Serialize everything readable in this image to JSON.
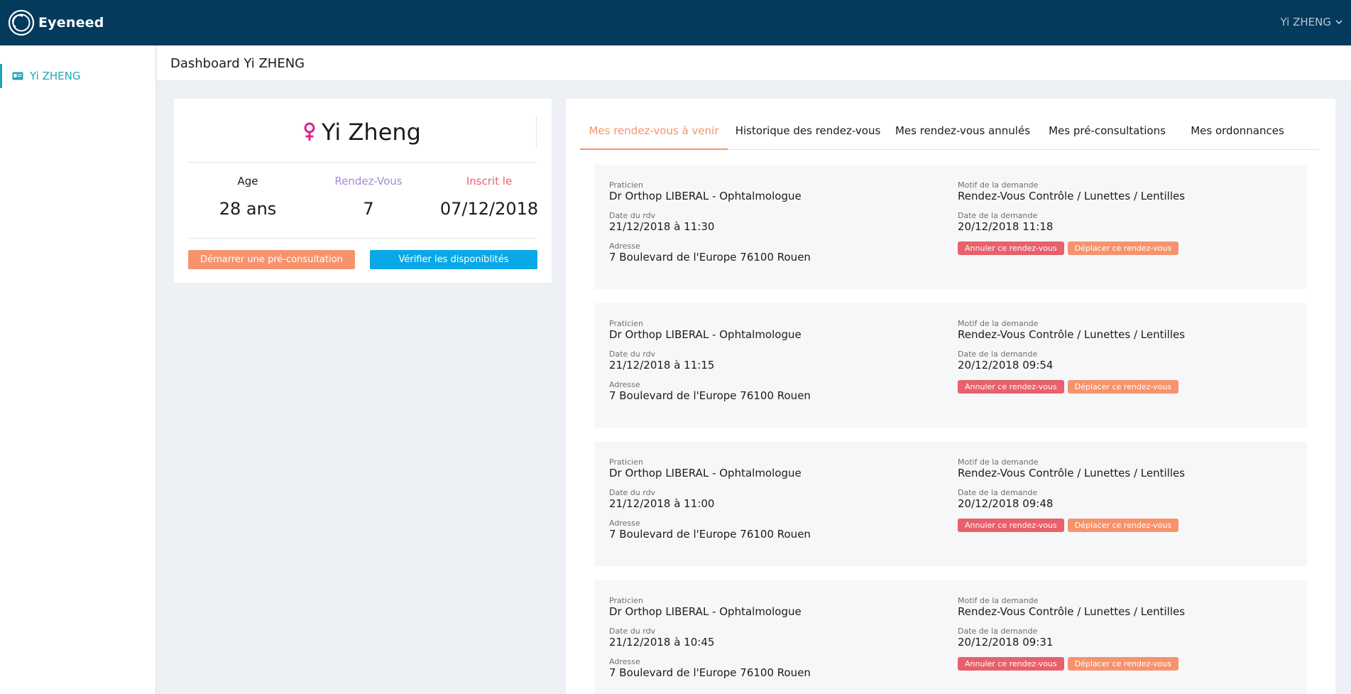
{
  "app": {
    "name": "Eyeneed",
    "user_menu": "Yi ZHENG"
  },
  "sidebar": {
    "items": [
      {
        "label": "Yi ZHENG",
        "icon": "id-card-icon"
      }
    ]
  },
  "page": {
    "title": "Dashboard Yi ZHENG"
  },
  "profile": {
    "gender_icon": "female-icon",
    "name": "Yi Zheng",
    "stats": [
      {
        "label": "Age",
        "value": "28 ans",
        "color": "#1b1b1b"
      },
      {
        "label": "Rendez-Vous",
        "value": "7",
        "color": "#a58ad6"
      },
      {
        "label": "Inscrit le",
        "value": "07/12/2018",
        "color": "#e8606b"
      }
    ],
    "start_button": "Démarrer une pré-consultation",
    "check_button": "Vérifier les disponiblités"
  },
  "tabs": [
    {
      "label": "Mes rendez-vous à venir",
      "active": true
    },
    {
      "label": "Historique des rendez-vous",
      "active": false
    },
    {
      "label": "Mes rendez-vous annulés",
      "active": false
    },
    {
      "label": "Mes pré-consultations",
      "active": false
    },
    {
      "label": "Mes ordonnances",
      "active": false
    }
  ],
  "labels": {
    "praticien": "Praticien",
    "date_rdv": "Date du rdv",
    "adresse": "Adresse",
    "motif": "Motif de la demande",
    "date_demande": "Date de la demande",
    "cancel": "Annuler ce rendez-vous",
    "move": "Déplacer ce rendez-vous"
  },
  "appointments": [
    {
      "praticien": "Dr Orthop LIBERAL - Ophtalmologue",
      "date_rdv": "21/12/2018 à 11:30",
      "adresse": "7 Boulevard de l'Europe 76100 Rouen",
      "motif": "Rendez-Vous Contrôle / Lunettes / Lentilles",
      "date_demande": "20/12/2018 11:18"
    },
    {
      "praticien": "Dr Orthop LIBERAL - Ophtalmologue",
      "date_rdv": "21/12/2018 à 11:15",
      "adresse": "7 Boulevard de l'Europe 76100 Rouen",
      "motif": "Rendez-Vous Contrôle / Lunettes / Lentilles",
      "date_demande": "20/12/2018 09:54"
    },
    {
      "praticien": "Dr Orthop LIBERAL - Ophtalmologue",
      "date_rdv": "21/12/2018 à 11:00",
      "adresse": "7 Boulevard de l'Europe 76100 Rouen",
      "motif": "Rendez-Vous Contrôle / Lunettes / Lentilles",
      "date_demande": "20/12/2018 09:48"
    },
    {
      "praticien": "Dr Orthop LIBERAL - Ophtalmologue",
      "date_rdv": "21/12/2018 à 10:45",
      "adresse": "7 Boulevard de l'Europe 76100 Rouen",
      "motif": "Rendez-Vous Contrôle / Lunettes / Lentilles",
      "date_demande": "20/12/2018 09:31"
    }
  ],
  "colors": {
    "topbar": "#043a5c",
    "accent_teal": "#1da7b8",
    "accent_orange": "#f6936d",
    "accent_blue": "#0aa8e6",
    "danger": "#e8606b"
  }
}
